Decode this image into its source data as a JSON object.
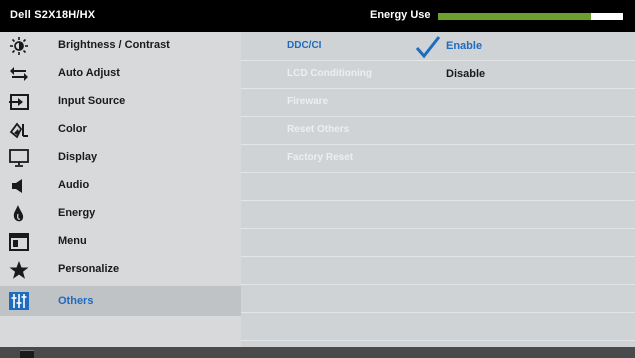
{
  "header": {
    "model": "Dell S2X18H/HX",
    "energy_label": "Energy Use",
    "energy_level": 0.83,
    "colors": {
      "energy_fill": "#6c9f2e",
      "energy_track": "#6b6b6b"
    }
  },
  "menu": {
    "items": [
      {
        "label": "Brightness / Contrast",
        "icon": "brightness-icon"
      },
      {
        "label": "Auto Adjust",
        "icon": "auto-adjust-icon"
      },
      {
        "label": "Input Source",
        "icon": "input-source-icon"
      },
      {
        "label": "Color",
        "icon": "color-icon"
      },
      {
        "label": "Display",
        "icon": "display-icon"
      },
      {
        "label": "Audio",
        "icon": "audio-icon"
      },
      {
        "label": "Energy",
        "icon": "energy-icon"
      },
      {
        "label": "Menu",
        "icon": "menu-icon"
      },
      {
        "label": "Personalize",
        "icon": "star-icon"
      },
      {
        "label": "Others",
        "icon": "others-icon",
        "selected": true
      }
    ]
  },
  "others": {
    "items": [
      {
        "label": "DDC/CI",
        "active": true
      },
      {
        "label": "LCD Conditioning"
      },
      {
        "label": "Fireware"
      },
      {
        "label": "Reset Others"
      },
      {
        "label": "Factory Reset"
      }
    ],
    "ddcci_options": {
      "enable": "Enable",
      "disable": "Disable",
      "selected": "Enable"
    }
  },
  "colors": {
    "accent": "#1e6bbf"
  }
}
